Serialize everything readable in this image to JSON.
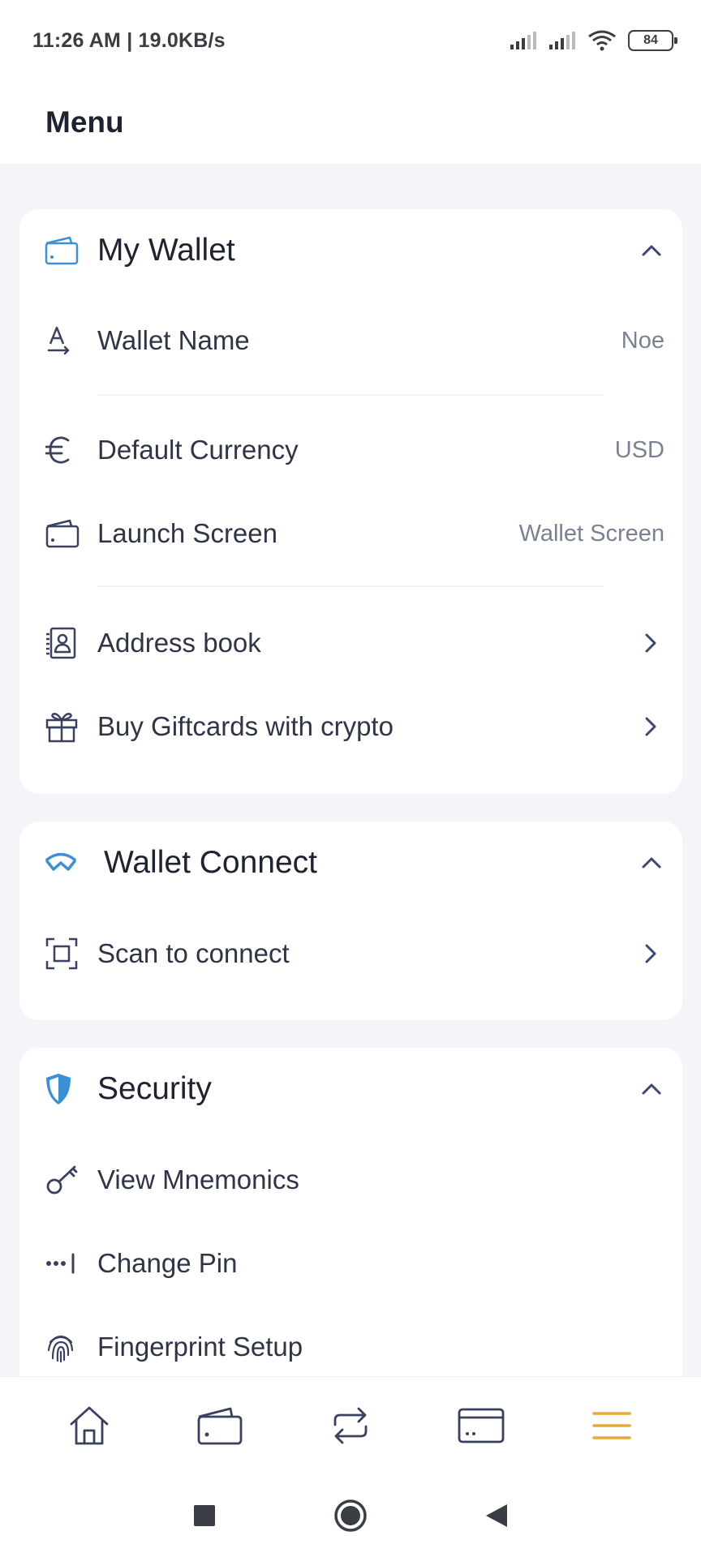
{
  "status_bar": {
    "time": "11:26 AM | 19.0KB/s",
    "battery": "84"
  },
  "header": {
    "title": "Menu"
  },
  "my_wallet": {
    "title": "My Wallet",
    "rows": [
      {
        "label": "Wallet Name",
        "value": "Noe",
        "icon": "text-a-icon"
      },
      {
        "label": "Default Currency",
        "value": "USD",
        "icon": "euro-icon"
      },
      {
        "label": "Launch Screen",
        "value": "Wallet Screen",
        "icon": "wallet-icon"
      },
      {
        "label": "Address book",
        "icon": "address-book-icon"
      },
      {
        "label": "Buy Giftcards with crypto",
        "icon": "gift-icon"
      }
    ]
  },
  "wallet_connect": {
    "title": "Wallet Connect",
    "rows": [
      {
        "label": "Scan to connect",
        "icon": "scan-icon"
      }
    ]
  },
  "security": {
    "title": "Security",
    "rows": [
      {
        "label": "View Mnemonics",
        "icon": "key-icon"
      },
      {
        "label": "Change Pin",
        "icon": "pin-dots-icon"
      },
      {
        "label": "Fingerprint Setup",
        "icon": "fingerprint-icon"
      }
    ]
  },
  "bottom_nav": {
    "items": [
      "home-icon",
      "wallet-icon",
      "swap-icon",
      "card-icon",
      "menu-icon"
    ],
    "active": "menu-icon"
  },
  "colors": {
    "accent": "#e8a93a",
    "icon_blue": "#3a8fd6",
    "icon_dark": "#3a4160",
    "chevron": "#3e4577"
  }
}
